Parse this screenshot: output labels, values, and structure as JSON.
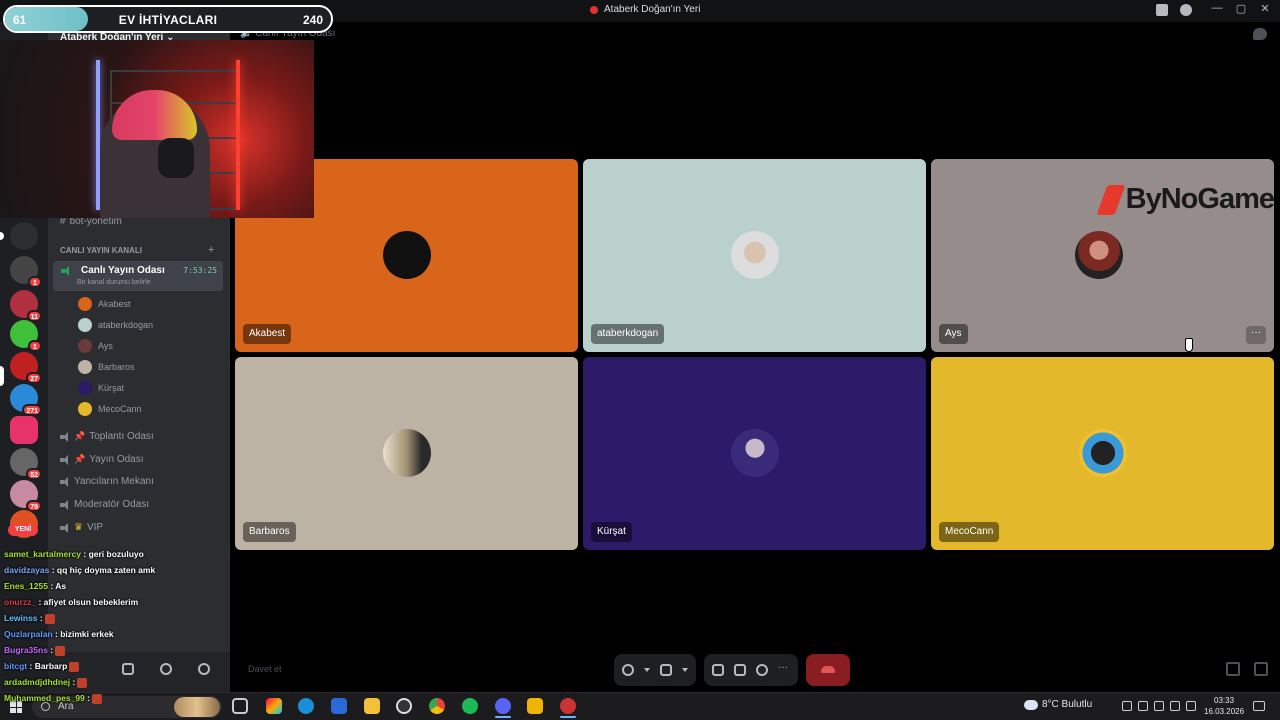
{
  "window": {
    "title": "Ataberk Doğan'ın Yeri",
    "controls": [
      "—",
      "▢",
      "✕"
    ]
  },
  "goal_bar": {
    "current": "61",
    "label": "EV İHTİYACLARI",
    "target": "240",
    "progress": 0.254
  },
  "server": {
    "name": "Ataberk Doğan'ın Yeri ⌄"
  },
  "server_list": {
    "badges": [
      "1",
      "11",
      "1",
      "27",
      "271",
      "52",
      "79"
    ],
    "new_label": "YENİ"
  },
  "channels": {
    "partial_top": "bot-yönetim",
    "category": "CANLI YAYIN KANALI",
    "active": {
      "name": "Canlı Yayın Odası",
      "time": "7:53:25",
      "status": "Bir kanal durumu belirle"
    },
    "voice_users": [
      "Akabest",
      "ataberkdogan",
      "Ays",
      "Barbaros",
      "Kürşat",
      "MecoCann"
    ],
    "others": [
      "Toplantı Odası",
      "Yayın Odası",
      "Yancıların Mekanı",
      "Moderatör Odası",
      "VIP"
    ]
  },
  "chat": [
    {
      "user": "samet_kartalmercy",
      "text": ": geri bozuluyo",
      "color": "#a6e22e"
    },
    {
      "user": "davidzayas",
      "text": ": qq hiç doyma zaten amk",
      "color": "#79a8ff"
    },
    {
      "user": "Enes_1255",
      "text": ": As",
      "color": "#a6e22e"
    },
    {
      "user": "onurzz_",
      "text": ": afiyet olsun bebeklerim",
      "color": "#e0354a"
    },
    {
      "user": "Lewinss",
      "text": ":",
      "color": "#5ec3ff"
    },
    {
      "user": "Quzlarpalan",
      "text": ": bizimki erkek",
      "color": "#5a9cff"
    },
    {
      "user": "Bugra35ns",
      "text": ":",
      "color": "#c267ff"
    },
    {
      "user": "bitcgt",
      "text": ": Barbarp",
      "color": "#5a9cff"
    },
    {
      "user": "ardadmdjdhdnej",
      "text": ":",
      "color": "#a6e22e"
    },
    {
      "user": "Muhammed_pes_99",
      "text": ":",
      "color": "#a6e22e"
    }
  ],
  "main": {
    "header": "Canlı Yayın Odası",
    "tiles": [
      {
        "name": "Akabest",
        "bg": "#d9651b"
      },
      {
        "name": "ataberkdogan",
        "bg": "#b9d0cd"
      },
      {
        "name": "Ays",
        "bg": "#968c8c",
        "brand": "ByNoGame",
        "more": "···"
      },
      {
        "name": "Barbaros",
        "bg": "#bdb3a4"
      },
      {
        "name": "Kürşat",
        "bg": "#2d1a69"
      },
      {
        "name": "MecoCann",
        "bg": "#e3b82b"
      }
    ],
    "invite": "Davet et"
  },
  "taskbar": {
    "search": "Ara",
    "weather": "8°C  Bulutlu",
    "time": "03:33",
    "date": "16.03.2026"
  }
}
